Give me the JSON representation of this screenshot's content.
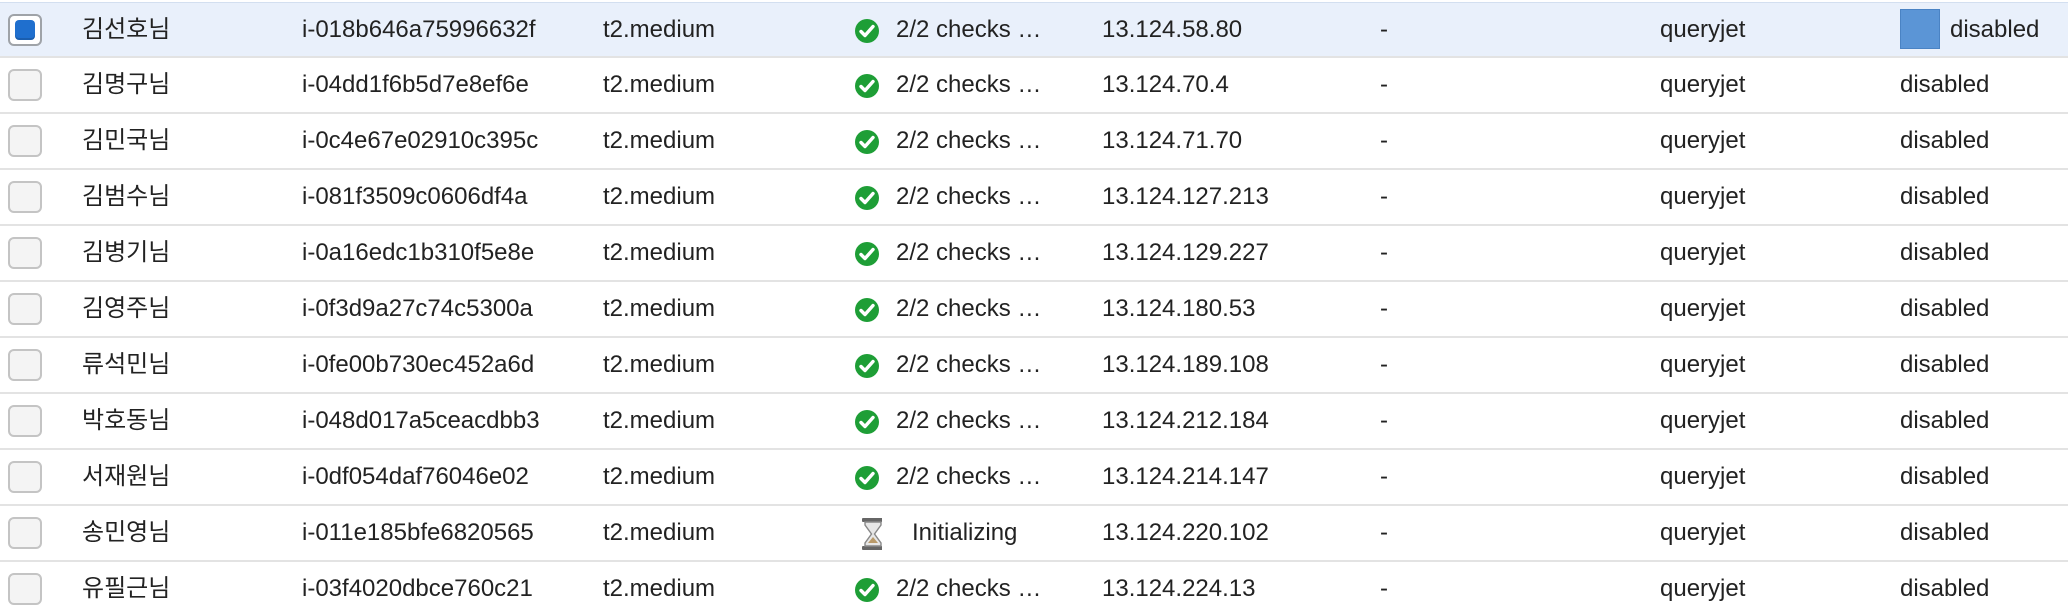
{
  "table": {
    "rows": [
      {
        "selected": true,
        "name": "김선호님",
        "instance_id": "i-018b646a75996632f",
        "type": "t2.medium",
        "status_icon": "check-circle-icon",
        "status": "2/2 checks …",
        "ip": "13.124.58.80",
        "ipv6": "-",
        "key": "queryjet",
        "monitoring": "disabled"
      },
      {
        "selected": false,
        "name": "김명구님",
        "instance_id": "i-04dd1f6b5d7e8ef6e",
        "type": "t2.medium",
        "status_icon": "check-circle-icon",
        "status": "2/2 checks …",
        "ip": "13.124.70.4",
        "ipv6": "-",
        "key": "queryjet",
        "monitoring": "disabled"
      },
      {
        "selected": false,
        "name": "김민국님",
        "instance_id": "i-0c4e67e02910c395c",
        "type": "t2.medium",
        "status_icon": "check-circle-icon",
        "status": "2/2 checks …",
        "ip": "13.124.71.70",
        "ipv6": "-",
        "key": "queryjet",
        "monitoring": "disabled"
      },
      {
        "selected": false,
        "name": "김범수님",
        "instance_id": "i-081f3509c0606df4a",
        "type": "t2.medium",
        "status_icon": "check-circle-icon",
        "status": "2/2 checks …",
        "ip": "13.124.127.213",
        "ipv6": "-",
        "key": "queryjet",
        "monitoring": "disabled"
      },
      {
        "selected": false,
        "name": "김병기님",
        "instance_id": "i-0a16edc1b310f5e8e",
        "type": "t2.medium",
        "status_icon": "check-circle-icon",
        "status": "2/2 checks …",
        "ip": "13.124.129.227",
        "ipv6": "-",
        "key": "queryjet",
        "monitoring": "disabled"
      },
      {
        "selected": false,
        "name": "김영주님",
        "instance_id": "i-0f3d9a27c74c5300a",
        "type": "t2.medium",
        "status_icon": "check-circle-icon",
        "status": "2/2 checks …",
        "ip": "13.124.180.53",
        "ipv6": "-",
        "key": "queryjet",
        "monitoring": "disabled"
      },
      {
        "selected": false,
        "name": "류석민님",
        "instance_id": "i-0fe00b730ec452a6d",
        "type": "t2.medium",
        "status_icon": "check-circle-icon",
        "status": "2/2 checks …",
        "ip": "13.124.189.108",
        "ipv6": "-",
        "key": "queryjet",
        "monitoring": "disabled"
      },
      {
        "selected": false,
        "name": "박호동님",
        "instance_id": "i-048d017a5ceacdbb3",
        "type": "t2.medium",
        "status_icon": "check-circle-icon",
        "status": "2/2 checks …",
        "ip": "13.124.212.184",
        "ipv6": "-",
        "key": "queryjet",
        "monitoring": "disabled"
      },
      {
        "selected": false,
        "name": "서재원님",
        "instance_id": "i-0df054daf76046e02",
        "type": "t2.medium",
        "status_icon": "check-circle-icon",
        "status": "2/2 checks …",
        "ip": "13.124.214.147",
        "ipv6": "-",
        "key": "queryjet",
        "monitoring": "disabled"
      },
      {
        "selected": false,
        "name": "송민영님",
        "instance_id": "i-011e185bfe6820565",
        "type": "t2.medium",
        "status_icon": "hourglass-icon",
        "status": "Initializing",
        "ip": "13.124.220.102",
        "ipv6": "-",
        "key": "queryjet",
        "monitoring": "disabled"
      },
      {
        "selected": false,
        "name": "유필근님",
        "instance_id": "i-03f4020dbce760c21",
        "type": "t2.medium",
        "status_icon": "check-circle-icon",
        "status": "2/2 checks …",
        "ip": "13.124.224.13",
        "ipv6": "-",
        "key": "queryjet",
        "monitoring": "disabled"
      }
    ]
  },
  "colors": {
    "selected_row": "#e9f0fb",
    "checkbox_selected": "#1f6fce",
    "status_ok": "#1e9e36",
    "monitoring_box": "#5b95d6"
  }
}
